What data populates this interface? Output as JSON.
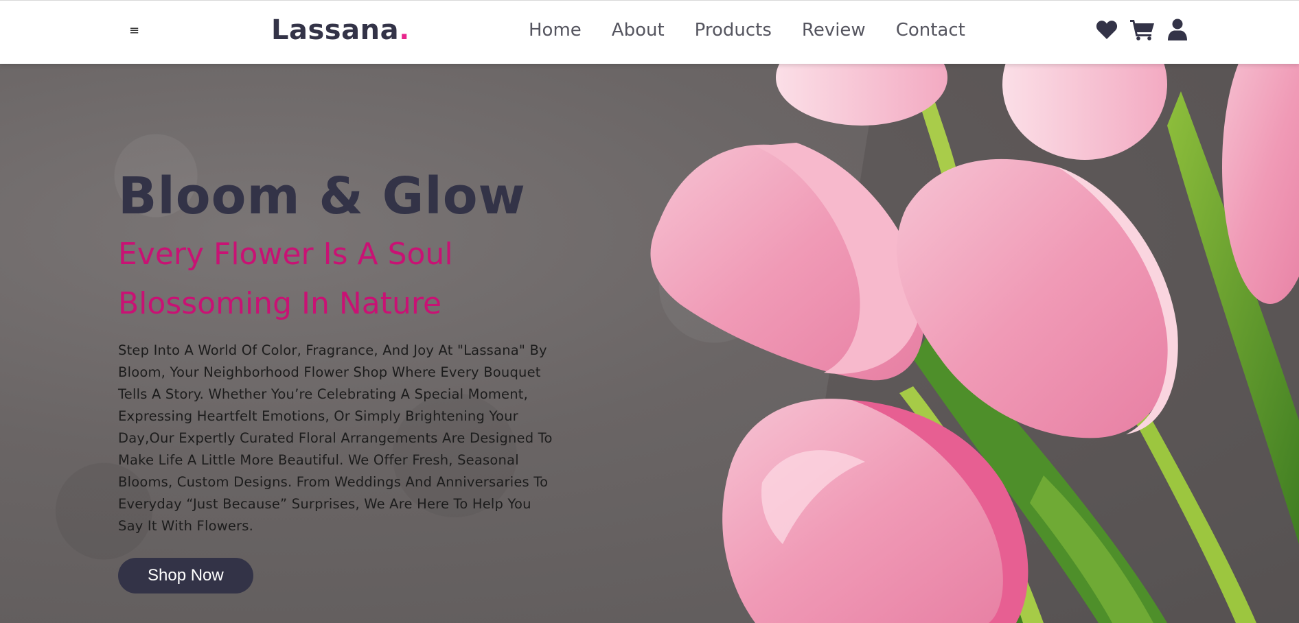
{
  "header": {
    "menu_icon": "≡",
    "logo_text": "Lassana",
    "logo_dot": ".",
    "nav": [
      {
        "label": "Home"
      },
      {
        "label": "About"
      },
      {
        "label": "Products"
      },
      {
        "label": "Review"
      },
      {
        "label": "Contact"
      }
    ],
    "icons": [
      "heart-icon",
      "cart-icon",
      "user-icon"
    ]
  },
  "hero": {
    "title": "Bloom & Glow",
    "subtitle_line1": "Every Flower Is A Soul",
    "subtitle_line2": "Blossoming In Nature",
    "description": "Step Into A World Of Color, Fragrance, And Joy At \"Lassana\" By Bloom, Your Neighborhood Flower Shop Where Every Bouquet Tells A Story. Whether You’re Celebrating A Special Moment, Expressing Heartfelt Emotions, Or Simply Brightening Your Day,Our Expertly Curated Floral Arrangements Are Designed To Make Life A Little More Beautiful. We Offer Fresh, Seasonal Blooms, Custom Designs. From Weddings And Anniversaries To Everyday “Just Because” Surprises, We Are Here To Help You Say It With Flowers.",
    "button_label": "Shop Now"
  },
  "colors": {
    "brand_dark": "#333347",
    "accent_pink": "#e8268c",
    "subtitle_pink": "#c81274"
  }
}
